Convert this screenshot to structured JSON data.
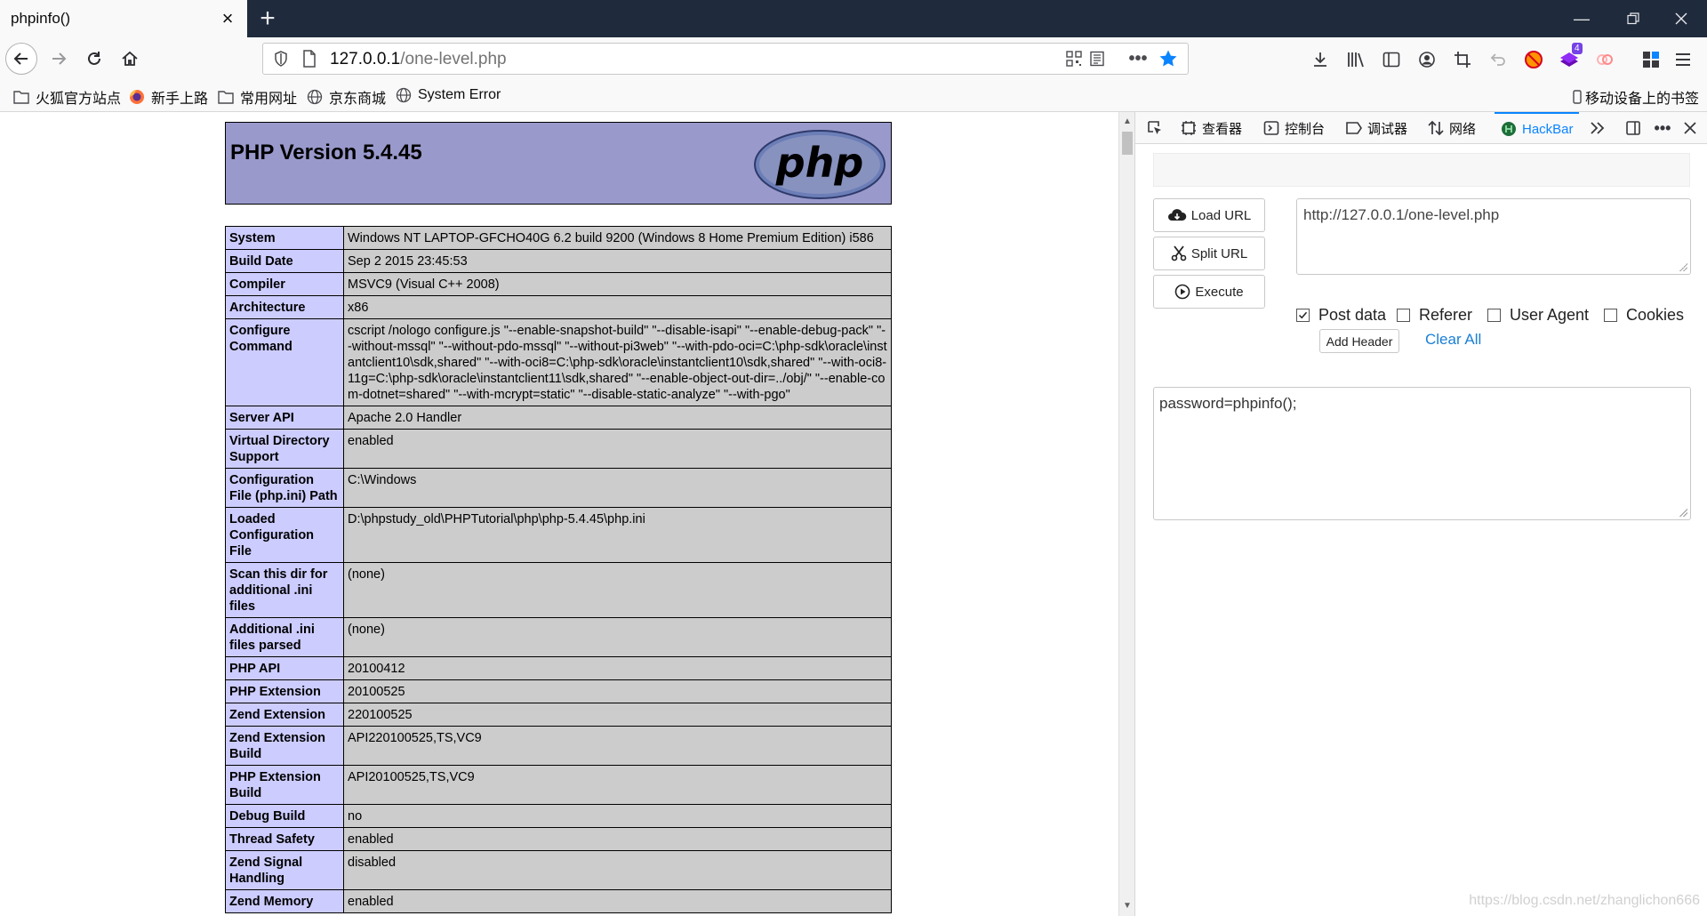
{
  "browser": {
    "tab_title": "phpinfo()",
    "url_host": "127.0.0.1",
    "url_path": "/one-level.php",
    "accent_color": "#0a84ff",
    "extension_badge": "4"
  },
  "bookmarks": [
    {
      "label": "火狐官方站点",
      "icon": "folder-icon"
    },
    {
      "label": "新手上路",
      "icon": "firefox-icon"
    },
    {
      "label": "常用网址",
      "icon": "folder-icon"
    },
    {
      "label": "京东商城",
      "icon": "globe-icon"
    },
    {
      "label": "System Error",
      "icon": "globe-icon"
    }
  ],
  "mobile_bookmarks": "移动设备上的书签",
  "php": {
    "version_title": "PHP Version 5.4.45",
    "logo_text": "php",
    "header_color": "#9999cc",
    "key_color": "#ccccff",
    "value_color": "#cccccc",
    "rows": [
      {
        "key": "System",
        "value": "Windows NT LAPTOP-GFCHO40G 6.2 build 9200 (Windows 8 Home Premium Edition) i586"
      },
      {
        "key": "Build Date",
        "value": "Sep 2 2015 23:45:53"
      },
      {
        "key": "Compiler",
        "value": "MSVC9 (Visual C++ 2008)"
      },
      {
        "key": "Architecture",
        "value": "x86"
      },
      {
        "key": "Configure Command",
        "value": "cscript /nologo configure.js \"--enable-snapshot-build\" \"--disable-isapi\" \"--enable-debug-pack\" \"--without-mssql\" \"--without-pdo-mssql\" \"--without-pi3web\" \"--with-pdo-oci=C:\\php-sdk\\oracle\\instantclient10\\sdk,shared\" \"--with-oci8=C:\\php-sdk\\oracle\\instantclient10\\sdk,shared\" \"--with-oci8-11g=C:\\php-sdk\\oracle\\instantclient11\\sdk,shared\" \"--enable-object-out-dir=../obj/\" \"--enable-com-dotnet=shared\" \"--with-mcrypt=static\" \"--disable-static-analyze\" \"--with-pgo\""
      },
      {
        "key": "Server API",
        "value": "Apache 2.0 Handler"
      },
      {
        "key": "Virtual Directory Support",
        "value": "enabled"
      },
      {
        "key": "Configuration File (php.ini) Path",
        "value": "C:\\Windows"
      },
      {
        "key": "Loaded Configuration File",
        "value": "D:\\phpstudy_old\\PHPTutorial\\php\\php-5.4.45\\php.ini"
      },
      {
        "key": "Scan this dir for additional .ini files",
        "value": "(none)"
      },
      {
        "key": "Additional .ini files parsed",
        "value": "(none)"
      },
      {
        "key": "PHP API",
        "value": "20100412"
      },
      {
        "key": "PHP Extension",
        "value": "20100525"
      },
      {
        "key": "Zend Extension",
        "value": "220100525"
      },
      {
        "key": "Zend Extension Build",
        "value": "API220100525,TS,VC9"
      },
      {
        "key": "PHP Extension Build",
        "value": "API20100525,TS,VC9"
      },
      {
        "key": "Debug Build",
        "value": "no"
      },
      {
        "key": "Thread Safety",
        "value": "enabled"
      },
      {
        "key": "Zend Signal Handling",
        "value": "disabled"
      },
      {
        "key": "Zend Memory",
        "value": "enabled"
      }
    ]
  },
  "devtools": {
    "tabs": [
      {
        "label": "查看器",
        "icon": "inspector-icon"
      },
      {
        "label": "控制台",
        "icon": "console-icon"
      },
      {
        "label": "调试器",
        "icon": "debugger-icon"
      },
      {
        "label": "网络",
        "icon": "network-icon"
      },
      {
        "label": "HackBar",
        "icon": "hackbar-icon",
        "active": true
      }
    ]
  },
  "hackbar": {
    "load_url": "Load URL",
    "split_url": "Split URL",
    "execute": "Execute",
    "url_value": "http://127.0.0.1/one-level.php",
    "checkboxes": [
      {
        "label": "Post data",
        "checked": true
      },
      {
        "label": "Referer",
        "checked": false
      },
      {
        "label": "User Agent",
        "checked": false
      },
      {
        "label": "Cookies",
        "checked": false
      }
    ],
    "add_header": "Add Header",
    "clear_all": "Clear All",
    "post_value": "password=phpinfo();"
  },
  "watermark": "https://blog.csdn.net/zhanglichon666"
}
